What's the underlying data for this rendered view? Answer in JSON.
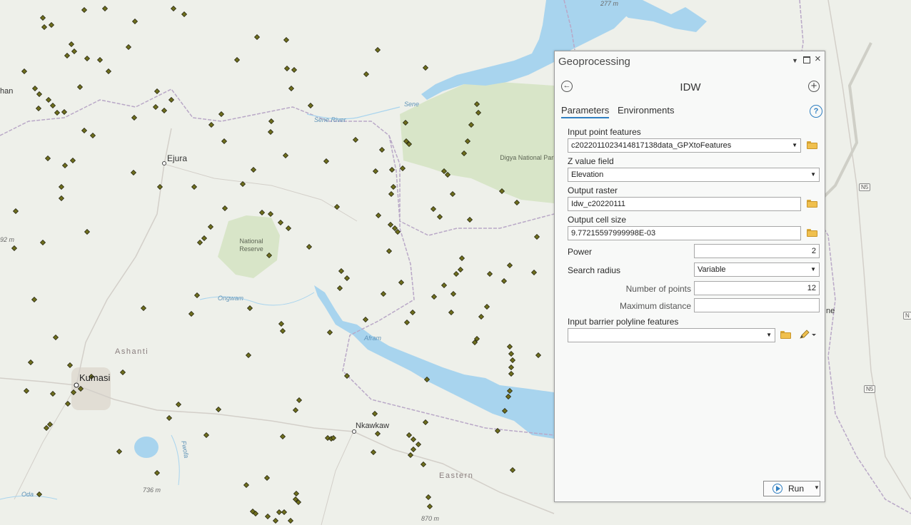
{
  "map": {
    "labels": {
      "ejura": "Ejura",
      "kumasi": "Kumasi",
      "nkawkaw": "Nkawkaw",
      "ashanti": "Ashanti",
      "eastern": "Eastern",
      "national_reserve": "National Reserve",
      "digya": "Digya National Park",
      "sene": "Sene",
      "sene_river": "Sene River",
      "afram": "Afram",
      "ongwam": "Ongwam",
      "fwofa": "Fwofa",
      "oda": "Oda",
      "elev_277": "277 m",
      "elev_736": "736 m",
      "elev_870": "870 m",
      "elev_92": "92 m",
      "frag_han": "han",
      "frag_ne": "ne",
      "n5_a": "N5",
      "n5_b": "N5",
      "n_right": "N"
    },
    "colors": {
      "land": "#eef0ea",
      "water": "#a8d4ee",
      "park": "#d8e5c8",
      "point": "#6e6e1e"
    }
  },
  "panel": {
    "title": "Geoprocessing",
    "tool_name": "IDW",
    "tabs": [
      "Parameters",
      "Environments"
    ],
    "help_symbol": "?",
    "params": {
      "input_point_features": {
        "label": "Input point features",
        "value": "c20220110234148171​38data_GPXtoFeatures"
      },
      "z_value_field": {
        "label": "Z value field",
        "value": "Elevation"
      },
      "output_raster": {
        "label": "Output raster",
        "value": "Idw_c20220111"
      },
      "output_cell_size": {
        "label": "Output cell size",
        "value": "9.77215597999998E-03"
      },
      "power": {
        "label": "Power",
        "value": "2"
      },
      "search_radius": {
        "label": "Search radius",
        "value": "Variable"
      },
      "number_of_points": {
        "label": "Number of points",
        "value": "12"
      },
      "maximum_distance": {
        "label": "Maximum distance",
        "value": ""
      },
      "input_barrier": {
        "label": "Input barrier polyline features",
        "value": ""
      }
    },
    "run_label": "Run"
  }
}
